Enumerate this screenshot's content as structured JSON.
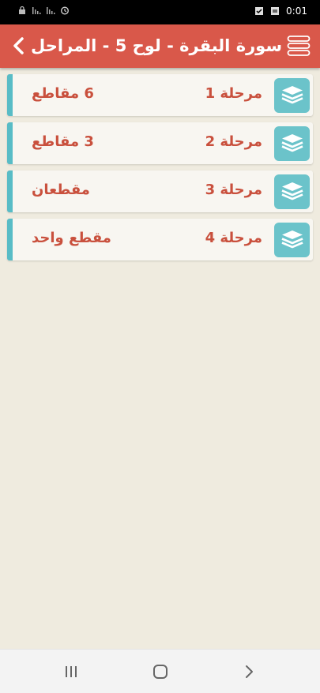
{
  "status_bar": {
    "time": "0:01",
    "left_icons": [
      "lock-icon",
      "signal-bars-icon",
      "signal-bars-icon",
      "alarm-icon"
    ],
    "right_icons": [
      "check-box-icon",
      "image-icon"
    ]
  },
  "header": {
    "title": "سورة البقرة - لوح 5 - المراحل",
    "back_icon": "chevron-left-icon",
    "menu_icon": "hamburger-menu-icon",
    "background": "#d9584a"
  },
  "stages": [
    {
      "label": "مرحلة 1",
      "count": "6 مقاطع"
    },
    {
      "label": "مرحلة 2",
      "count": "3 مقاطع"
    },
    {
      "label": "مرحلة 3",
      "count": "مقطعان"
    },
    {
      "label": "مرحلة 4",
      "count": "مقطع واحد"
    }
  ],
  "colors": {
    "accent": "#58bcc6",
    "text": "#c9503d",
    "page_background": "#efebdf"
  },
  "nav_bar": {
    "icons": [
      "recent-apps-icon",
      "home-icon",
      "back-icon"
    ]
  }
}
